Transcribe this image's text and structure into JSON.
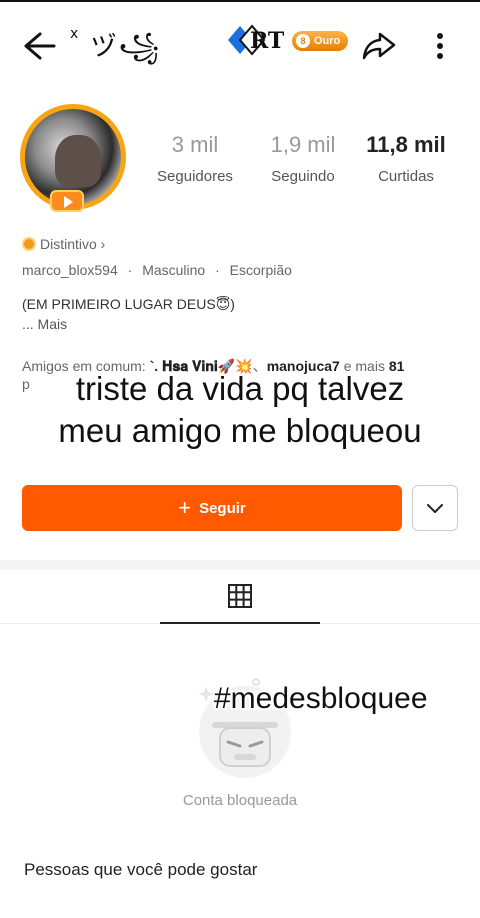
{
  "topbar": {
    "username_deco_small": "x",
    "username_deco": "ヅ꧁",
    "logo_text": "RT",
    "badge_label": "Ouro"
  },
  "profile": {
    "stats": [
      {
        "value": "3 mil",
        "label": "Seguidores"
      },
      {
        "value": "1,9 mil",
        "label": "Seguindo"
      },
      {
        "value": "11,8 mil",
        "label": "Curtidas"
      }
    ],
    "distintivo": "Distintivo ›",
    "meta": [
      "marco_blox594",
      "Masculino",
      "Escorpião"
    ],
    "bio": "(EM PRIMEIRO LUGAR DEUS😇)",
    "bio_more": "...  Mais",
    "mutual_prefix": "Amigos em comum:",
    "mutual_name_1": "`. 𝐇𝐬𝐚 𝐕𝐢𝐧𝐢🚀💥",
    "mutual_sep": "、",
    "mutual_name_2": "manojuca7",
    "mutual_suffix": " e mais ",
    "mutual_count": "81",
    "mutual_line2": "p"
  },
  "overlay": {
    "caption_line1": "triste da vida pq talvez",
    "caption_line2": "meu amigo me bloqueou",
    "hashtag": "#medesbloquee"
  },
  "actions": {
    "follow_label": "Seguir"
  },
  "content": {
    "blocked_label": "Conta bloqueada",
    "suggestions_title": "Pessoas que você pode gostar"
  },
  "colors": {
    "accent": "#ff5a00",
    "gold": "#f7a415",
    "muted": "#999999"
  }
}
